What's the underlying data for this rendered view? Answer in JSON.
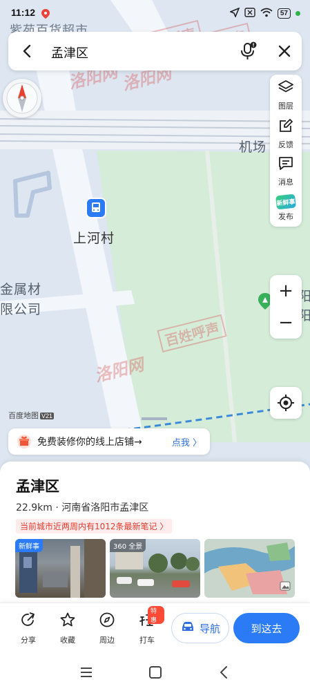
{
  "status_bar": {
    "time": "11:12",
    "battery": "57"
  },
  "search": {
    "query": "孟津区"
  },
  "map": {
    "top_label": "紫苑百货超市",
    "airport_label": "机场",
    "poi_label": "上河村",
    "company_label_line1": "金属材",
    "company_label_line2": "限公司",
    "edge_label_1": "阳",
    "edge_label_2": "阳",
    "brand": "百度地图",
    "brand_version": "V21",
    "watermark": "洛阳网 百姓呼声",
    "watermark_part_a": "洛阳网",
    "watermark_part_b": "百姓呼声",
    "colors": {
      "water": "#dde6f1",
      "park": "#d5ecd9",
      "road": "#f3f6fa",
      "rail": "#c3ccd8",
      "boundary": "#3b8ad9"
    }
  },
  "tools": {
    "layers": "图层",
    "feedback": "反馈",
    "messages": "消息",
    "fresh_badge": "新鲜事",
    "publish": "发布"
  },
  "zoom": {
    "in": "+",
    "out": "−"
  },
  "promo": {
    "text": "免费装修你的线上店铺→",
    "link": "点我 〉"
  },
  "place": {
    "name": "孟津区",
    "meta": "22.9km · 河南省洛阳市孟津区",
    "notes": "当前城市近两周内有1012条最新笔记 〉",
    "photos": [
      {
        "tag": "新鲜事"
      },
      {
        "tag": "360 全景"
      },
      {
        "tag": ""
      }
    ]
  },
  "actions": {
    "share": "分享",
    "favorite": "收藏",
    "nearby": "周边",
    "taxi": "打车",
    "taxi_badge": "特惠",
    "navigate": "导航",
    "go_here": "到这去"
  },
  "colors": {
    "accent": "#2b7bf6",
    "notes_red": "#e23b2e"
  }
}
